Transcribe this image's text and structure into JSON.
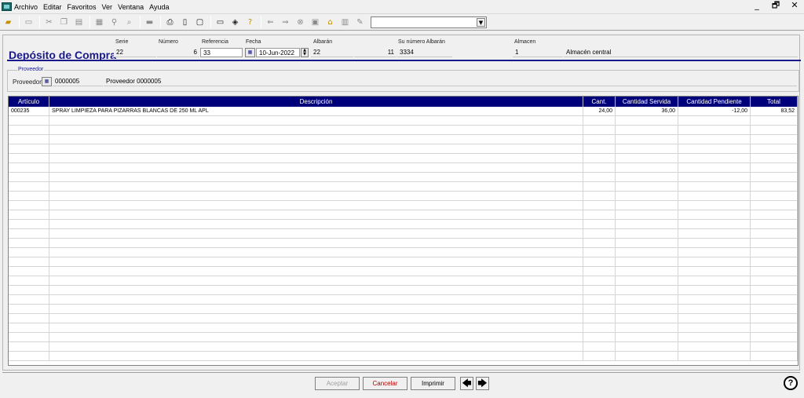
{
  "menu": [
    "Archivo",
    "Editar",
    "Favoritos",
    "Ver",
    "Ventana",
    "Ayuda"
  ],
  "window_controls": {
    "minimize": "_",
    "restore": "🗗",
    "close": "✕"
  },
  "toolbar": {
    "icons": [
      "open-folder",
      "new-doc",
      "cut",
      "copy",
      "paste",
      "select",
      "find",
      "search",
      "save",
      "print",
      "print-preview",
      "preview",
      "window",
      "tag",
      "help",
      "back",
      "forward",
      "stop",
      "save-disk",
      "home",
      "bookmark",
      "edit"
    ]
  },
  "header": {
    "title": "Depósito de Compra",
    "labels": {
      "serie": "Serie",
      "numero": "Número",
      "referencia": "Referencia",
      "fecha": "Fecha",
      "albaran": "Albarán",
      "su_numero": "Su número Albarán",
      "almacen": "Almacen"
    },
    "values": {
      "serie": "22",
      "numero": "6",
      "referencia": "33",
      "fecha": "10-Jun-2022",
      "albaran_serie": "22",
      "albaran_num": "11",
      "su_numero": "3334",
      "almacen_code": "1",
      "almacen_name": "Almacén central"
    }
  },
  "proveedor": {
    "legend": "Proveedor",
    "label": "Proveedor",
    "code": "0000005",
    "name": "Proveedor 0000005"
  },
  "grid": {
    "headers": [
      "Artículo",
      "Descripción",
      "Cant.",
      "Cantidad Servida",
      "Cantidad Pendiente",
      "Total"
    ],
    "rows": [
      {
        "articulo": "000235",
        "descripcion": "SPRAY LIMPIEZA PARA PIZARRAS BLANCAS DE 250 ML APL",
        "cant": "24,00",
        "servida": "36,00",
        "pendiente": "-12,00",
        "total": "83,52"
      }
    ]
  },
  "buttons": {
    "aceptar": "Aceptar",
    "cancelar": "Cancelar",
    "imprimir": "Imprimir",
    "help": "?"
  }
}
